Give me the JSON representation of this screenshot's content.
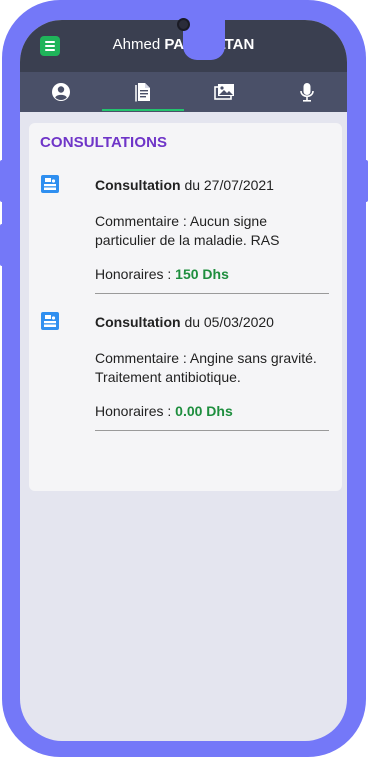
{
  "header": {
    "first_name": "Ahmed",
    "last_name": "PASOULTAN",
    "menu_icon": "hamburger-menu-icon"
  },
  "tabs": [
    {
      "icon": "user-circle-icon",
      "active": false
    },
    {
      "icon": "document-icon",
      "active": true
    },
    {
      "icon": "images-icon",
      "active": false
    },
    {
      "icon": "microphone-icon",
      "active": false
    }
  ],
  "consultations": {
    "title": "CONSULTATIONS",
    "items": [
      {
        "label": "Consultation",
        "date_text": "du 27/07/2021",
        "comment": "Commentaire : Aucun signe particulier de la maladie. RAS",
        "fees_label": "Honoraires :",
        "fees_value": "150 Dhs"
      },
      {
        "label": "Consultation",
        "date_text": "du 05/03/2020",
        "comment": "Commentaire : Angine sans gravité. Traitement antibiotique.",
        "fees_label": "Honoraires :",
        "fees_value": "0.00 Dhs"
      }
    ]
  },
  "colors": {
    "frame": "#7478f8",
    "topbar": "#3a3f50",
    "tabbar": "#4a5068",
    "accent_green": "#23c46e",
    "section_title": "#6f35c8",
    "fees_value": "#1e8e3e",
    "consultation_icon": "#2f8ff0"
  }
}
